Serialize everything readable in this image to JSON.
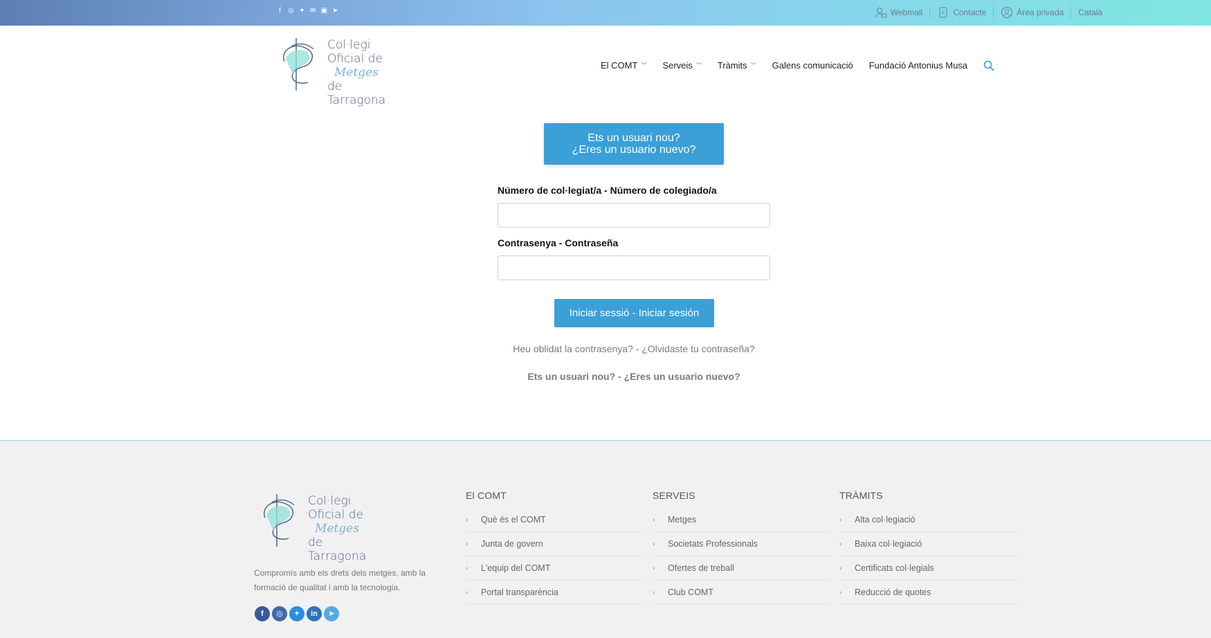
{
  "topbar": {
    "social_icons": [
      "facebook-icon",
      "instagram-icon",
      "twitter-icon",
      "email-icon",
      "linkedin-icon",
      "telegram-icon"
    ],
    "links": [
      {
        "icon": "webmail-icon",
        "label": "Webmail"
      },
      {
        "icon": "contact-icon",
        "label": "Contacte"
      },
      {
        "icon": "private-area-icon",
        "label": "Àrea privada"
      },
      {
        "icon": "",
        "label": "Català"
      }
    ]
  },
  "header": {
    "logo_lines": [
      "Col·legi",
      "Oficial de",
      "Metges",
      "de Tarragona"
    ],
    "nav": [
      {
        "label": "El COMT",
        "dropdown": true
      },
      {
        "label": "Serveis",
        "dropdown": true
      },
      {
        "label": "Tràmits",
        "dropdown": true
      },
      {
        "label": "Galens comunicació",
        "dropdown": false
      },
      {
        "label": "Fundació Antonius Musa",
        "dropdown": false
      }
    ]
  },
  "login": {
    "new_user_button_line1": "Ets un usuari nou?",
    "new_user_button_line2": "¿Eres un usuario nuevo?",
    "username_label": "Número de col·legiat/a - Número de colegiado/a",
    "username_value": "",
    "password_label": "Contrasenya - Contraseña",
    "password_value": "",
    "submit_label": "Iniciar sessió - Iniciar sesión",
    "forgot_link": "Heu oblidat la contrasenya? - ¿Olvidaste tu contraseña?",
    "new_user_link": "Ets un usuari nou? - ¿Eres un usuario nuevo?"
  },
  "footer": {
    "tagline": "Compromís amb els drets dels metges, amb la formació de qualitat i amb la tecnologia.",
    "social_icons": [
      "facebook-icon",
      "instagram-icon",
      "twitter-icon",
      "linkedin-icon",
      "telegram-icon"
    ],
    "columns": [
      {
        "title": "El COMT",
        "items": [
          "Què és el COMT",
          "Junta de govern",
          "L'equip del COMT",
          "Portal transparència"
        ]
      },
      {
        "title": "SERVEIS",
        "items": [
          "Metges",
          "Societats Professionals",
          "Ofertes de treball",
          "Club COMT"
        ]
      },
      {
        "title": "TRÀMITS",
        "items": [
          "Alta col·legiació",
          "Baixa col·legiació",
          "Certificats col·legials",
          "Reducció de quotes"
        ]
      }
    ]
  },
  "colors": {
    "accent": "#3b9fd8",
    "footer_bg": "#f1f1f1"
  }
}
